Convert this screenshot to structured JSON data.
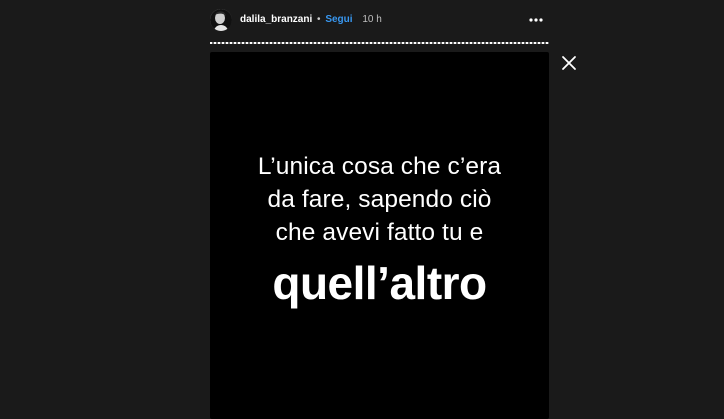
{
  "header": {
    "username": "dalila_branzani",
    "separator": "•",
    "follow_label": "Segui",
    "time": "10 h",
    "more_icon": "more-horizontal-icon"
  },
  "progress": {
    "fraction": 1.0
  },
  "close_icon": "close-icon",
  "story": {
    "lines": [
      "L’unica cosa che c’era",
      "da fare, sapendo ciò",
      "che avevi fatto tu e"
    ],
    "emphasis": "quell’altro"
  },
  "colors": {
    "background": "#1a1a1a",
    "story_bg": "#000000",
    "text": "#ffffff",
    "follow": "#3897f0"
  }
}
